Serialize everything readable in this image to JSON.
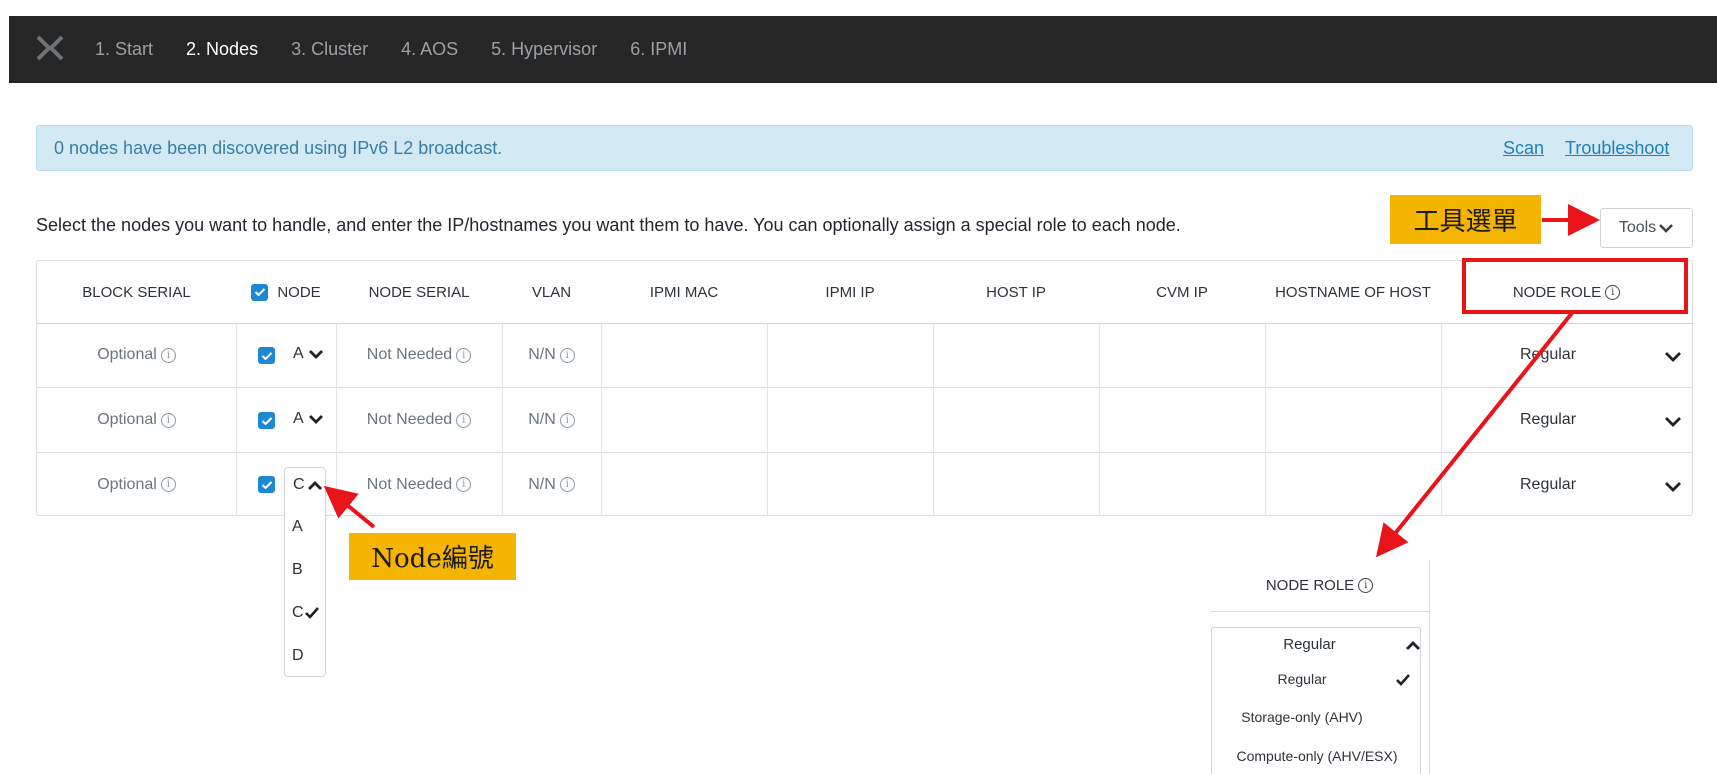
{
  "nav": {
    "logo_icon": "nutanix-x-logo",
    "steps": [
      {
        "label": "1. Start",
        "active": false
      },
      {
        "label": "2. Nodes",
        "active": true
      },
      {
        "label": "3. Cluster",
        "active": false
      },
      {
        "label": "4. AOS",
        "active": false
      },
      {
        "label": "5. Hypervisor",
        "active": false
      },
      {
        "label": "6. IPMI",
        "active": false
      }
    ]
  },
  "banner": {
    "text": "0 nodes have been discovered using IPv6 L2 broadcast.",
    "scan_link": "Scan",
    "troubleshoot_link": "Troubleshoot"
  },
  "instruction": "Select the nodes you want to handle, and enter the IP/hostnames you want them to have. You can optionally assign a special role to each node.",
  "tools_button": "Tools",
  "annotations": {
    "tools_menu": "工具選單",
    "node_number": "Node編號",
    "highlight_color": "#e8141a",
    "tag_color": "#f5b400"
  },
  "table": {
    "headers": {
      "block_serial": "BLOCK SERIAL",
      "node": "NODE",
      "node_serial": "NODE SERIAL",
      "vlan": "VLAN",
      "ipmi_mac": "IPMI MAC",
      "ipmi_ip": "IPMI IP",
      "host_ip": "HOST IP",
      "cvm_ip": "CVM IP",
      "hostname": "HOSTNAME OF HOST",
      "node_role": "NODE ROLE"
    },
    "rows": [
      {
        "block_serial": "Optional",
        "node": "A",
        "node_serial": "Not Needed",
        "vlan": "N/N",
        "role": "Regular",
        "checked": true
      },
      {
        "block_serial": "Optional",
        "node": "A",
        "node_serial": "Not Needed",
        "vlan": "N/N",
        "role": "Regular",
        "checked": true
      },
      {
        "block_serial": "Optional",
        "node": "C",
        "node_serial": "Not Needed",
        "vlan": "N/N",
        "role": "Regular",
        "checked": true
      }
    ]
  },
  "node_dropdown": {
    "current": "C",
    "options": [
      "A",
      "B",
      "C",
      "D"
    ],
    "selected": "C"
  },
  "role_panel": {
    "header": "NODE ROLE",
    "current": "Regular",
    "options": [
      "Regular",
      "Storage-only (AHV)",
      "Compute-only (AHV/ESX)"
    ],
    "selected": "Regular"
  }
}
